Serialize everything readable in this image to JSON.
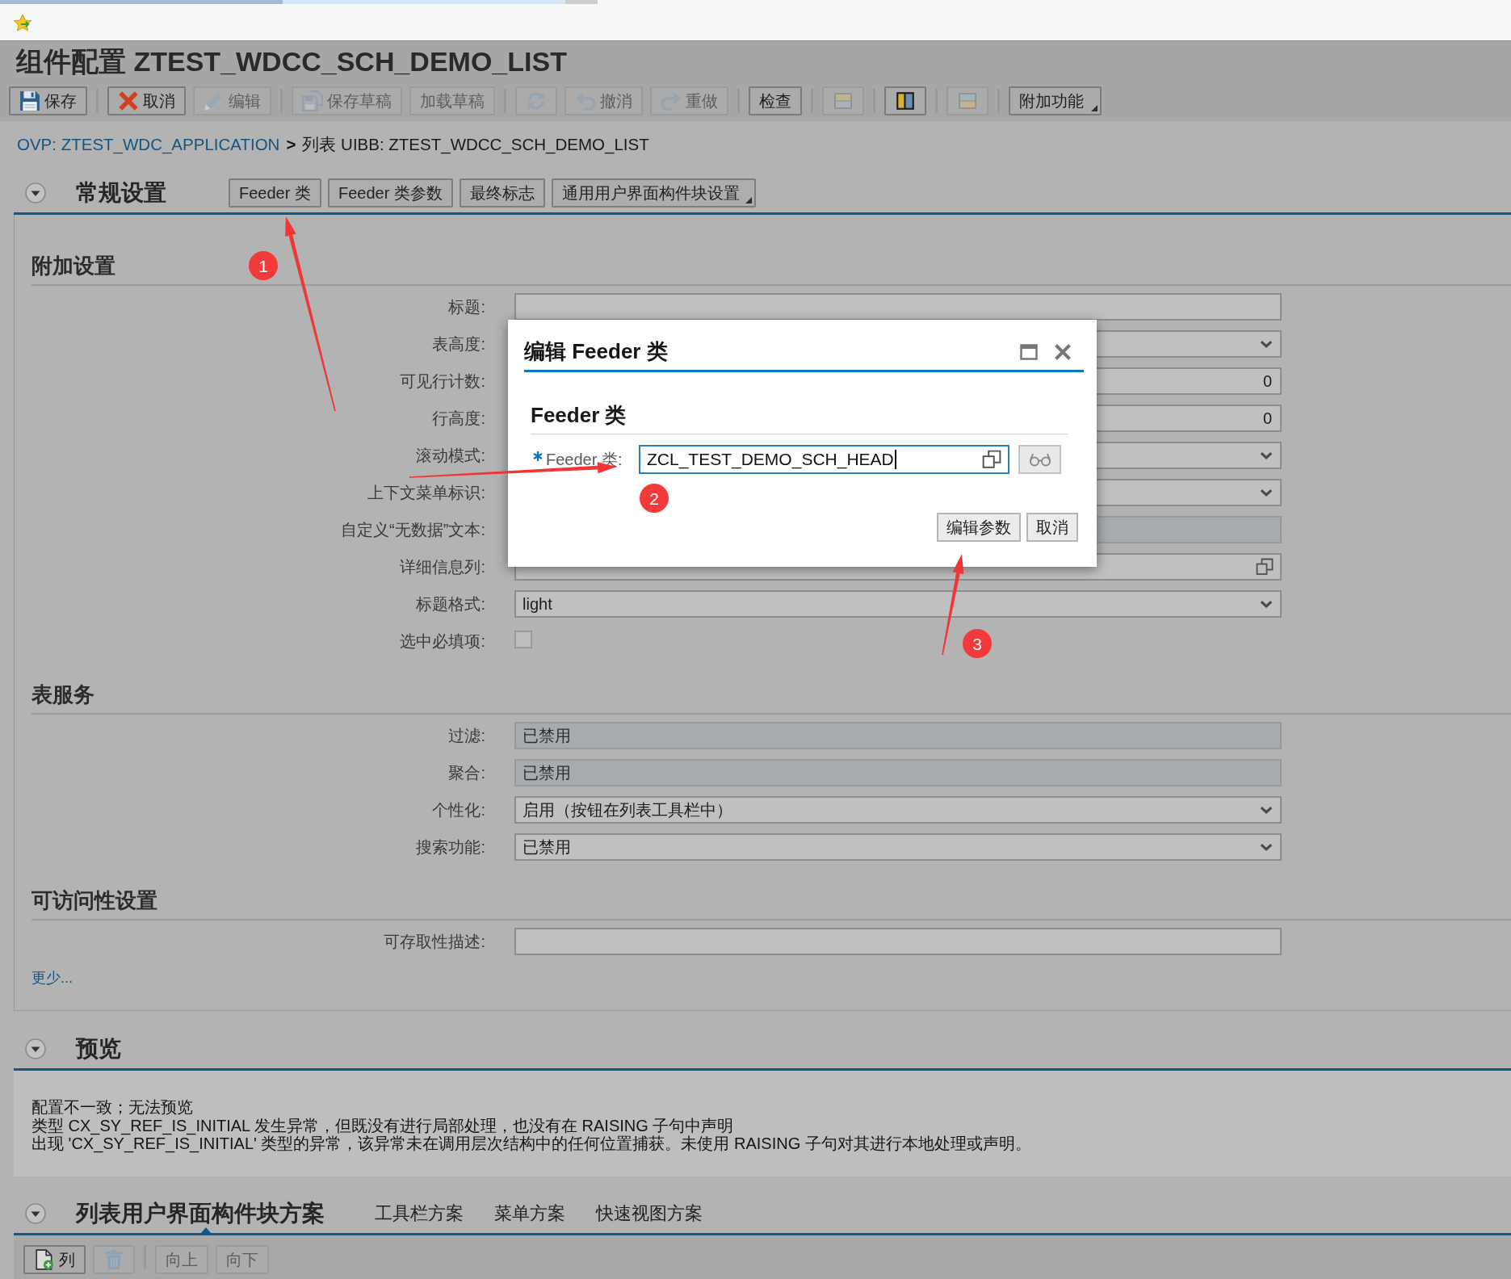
{
  "page": {
    "title": "组件配置 ZTEST_WDCC_SCH_DEMO_LIST"
  },
  "toolbar": [
    [
      {
        "label": "保存",
        "kind": "button",
        "disabled": false
      }
    ],
    [
      {
        "label": "取消",
        "kind": "button",
        "disabled": false
      },
      {
        "label": "编辑",
        "kind": "button",
        "disabled": true
      }
    ],
    [
      {
        "label": "保存草稿",
        "kind": "button",
        "disabled": true
      },
      {
        "label": "加载草稿",
        "kind": "button",
        "disabled": true
      }
    ],
    [
      {
        "kind": "button",
        "disabled": true
      },
      {
        "label": "撤消",
        "kind": "button",
        "disabled": true
      },
      {
        "label": "重做",
        "kind": "button",
        "disabled": true
      }
    ],
    [
      {
        "label": "检查",
        "kind": "button",
        "disabled": false
      }
    ],
    [
      {
        "kind": "button",
        "disabled": true
      }
    ],
    [
      {
        "kind": "button",
        "disabled": false
      }
    ],
    [
      {
        "kind": "button",
        "disabled": true
      }
    ],
    [
      {
        "label": "附加功能",
        "kind": "menu",
        "disabled": false
      }
    ]
  ],
  "breadcrumb": {
    "link": "OVP: ZTEST_WDC_APPLICATION",
    "separator": ">",
    "current": "列表 UIBB: ZTEST_WDCC_SCH_DEMO_LIST"
  },
  "general_settings": {
    "title": "常规设置",
    "expanded": true,
    "buttons": [
      {
        "label": "Feeder 类",
        "kind": "button"
      },
      {
        "label": "Feeder 类参数",
        "kind": "button"
      },
      {
        "label": "最终标志",
        "kind": "button"
      },
      {
        "label": "通用用户界面构件块设置",
        "kind": "menu"
      }
    ],
    "groups": [
      {
        "title": "附加设置",
        "fields": [
          {
            "label": "标题:",
            "kind": "text",
            "disabled": false
          },
          {
            "label": "表高度:",
            "kind": "select",
            "disabled": false
          },
          {
            "label": "可见行计数:",
            "kind": "number",
            "value": "0",
            "disabled": false
          },
          {
            "label": "行高度:",
            "kind": "number",
            "value": "0",
            "disabled": false
          },
          {
            "label": "滚动模式:",
            "kind": "select",
            "disabled": false
          },
          {
            "label": "上下文菜单标识:",
            "kind": "select",
            "disabled": false
          },
          {
            "label": "自定义“无数据”文本:",
            "kind": "text",
            "disabled": true
          },
          {
            "label": "详细信息列:",
            "kind": "value_help",
            "disabled": false
          },
          {
            "label": "标题格式:",
            "kind": "select",
            "value": "light",
            "disabled": false
          },
          {
            "label": "选中必填项:",
            "kind": "checkbox",
            "checked": false,
            "disabled": false
          }
        ]
      },
      {
        "title": "表服务",
        "fields": [
          {
            "label": "过滤:",
            "kind": "text",
            "value": "已禁用",
            "disabled": true
          },
          {
            "label": "聚合:",
            "kind": "text",
            "value": "已禁用",
            "disabled": true
          },
          {
            "label": "个性化:",
            "kind": "select",
            "value": "启用（按钮在列表工具栏中）",
            "disabled": false
          },
          {
            "label": "搜索功能:",
            "kind": "select",
            "value": "已禁用",
            "disabled": false
          }
        ]
      },
      {
        "title": "可访问性设置",
        "fields": [
          {
            "label": "可存取性描述:",
            "kind": "text",
            "disabled": false
          }
        ]
      }
    ],
    "less_link": "更少..."
  },
  "preview": {
    "title": "预览",
    "expanded": true,
    "lines": [
      "配置不一致；无法预览",
      "类型 CX_SY_REF_IS_INITIAL 发生异常，但既没有进行局部处理，也没有在 RAISING 子句中声明",
      "出现 'CX_SY_REF_IS_INITIAL' 类型的异常，该异常未在调用层次结构中的任何位置捕获。未使用 RAISING 子句对其进行本地处理或声明。"
    ]
  },
  "schemes": {
    "expanded": true,
    "tabs": [
      {
        "label": "列表用户界面构件块方案",
        "selected": true
      },
      {
        "label": "工具栏方案",
        "selected": false
      },
      {
        "label": "菜单方案",
        "selected": false
      },
      {
        "label": "快速视图方案",
        "selected": false
      }
    ],
    "toolbar": [
      [
        {
          "label": "列",
          "kind": "button",
          "disabled": false
        },
        {
          "kind": "button",
          "disabled": true
        }
      ],
      [
        {
          "label": "向上",
          "kind": "button",
          "disabled": true
        },
        {
          "label": "向下",
          "kind": "button",
          "disabled": true
        }
      ]
    ]
  },
  "dialog": {
    "title": "编辑 Feeder 类",
    "group_title": "Feeder 类",
    "field": {
      "label": "Feeder 类:",
      "required": true,
      "value": "ZCL_TEST_DEMO_SCH_HEAD",
      "focused": true
    },
    "buttons": [
      {
        "label": "编辑参数"
      },
      {
        "label": "取消"
      }
    ]
  },
  "annotations": [
    {
      "number": "1"
    },
    {
      "number": "2"
    },
    {
      "number": "3"
    }
  ]
}
